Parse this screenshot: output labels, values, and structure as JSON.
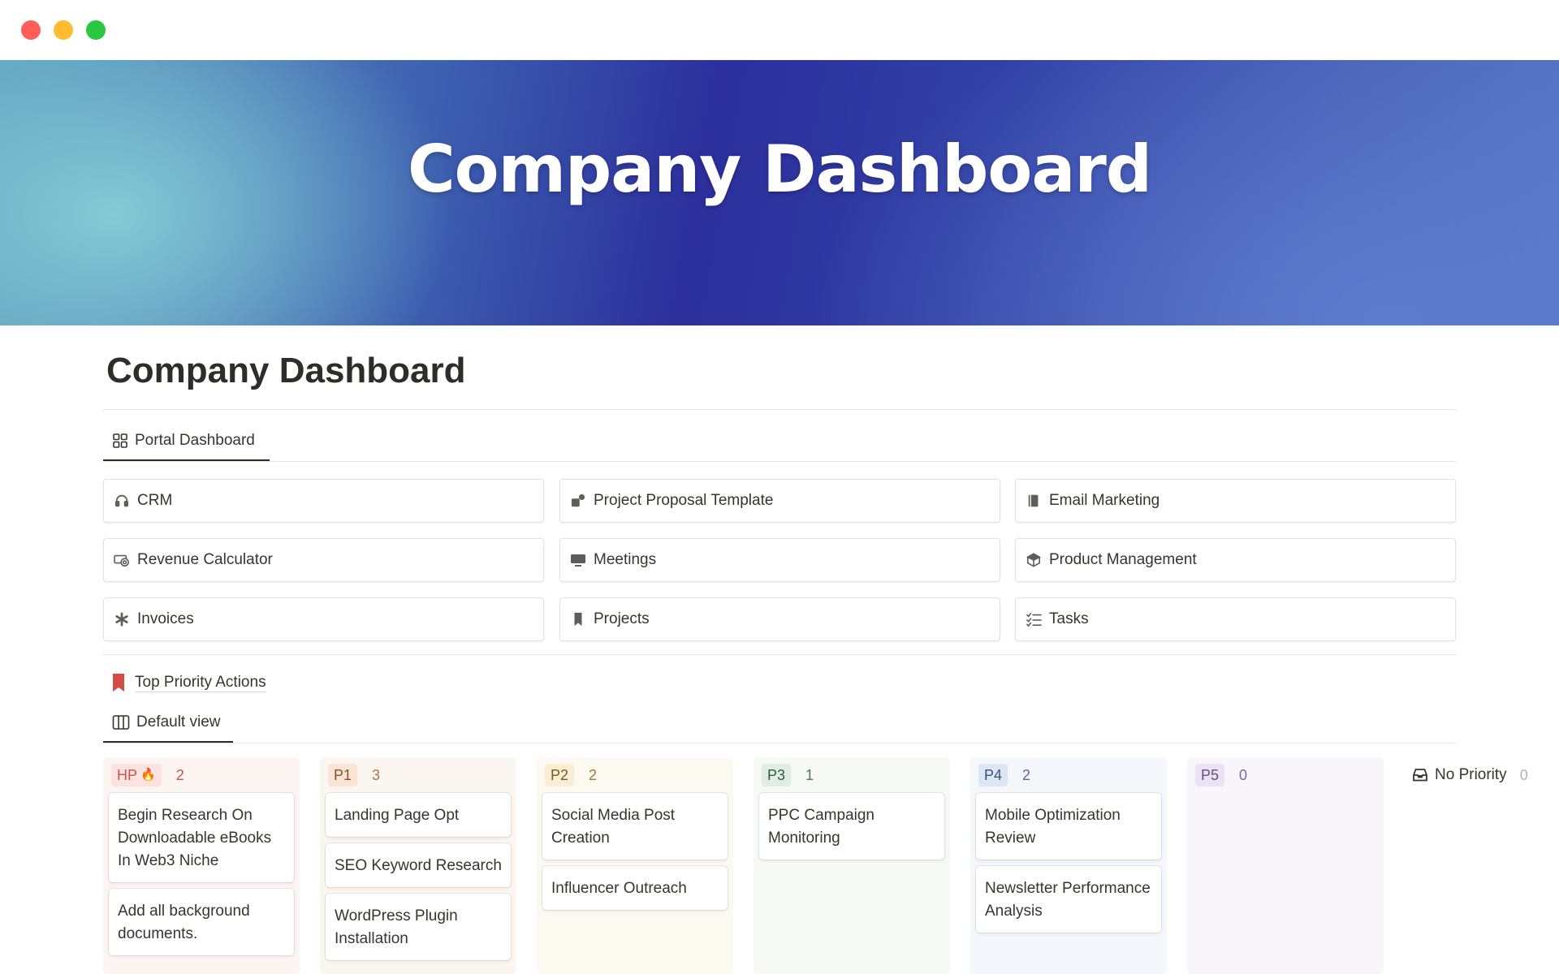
{
  "window": {
    "controls": [
      "close",
      "minimize",
      "zoom"
    ]
  },
  "banner": {
    "title": "Company Dashboard"
  },
  "page": {
    "title": "Company Dashboard"
  },
  "portal_tab": {
    "label": "Portal Dashboard",
    "icon": "grid-icon"
  },
  "links": [
    {
      "label": "CRM",
      "icon": "headset-icon"
    },
    {
      "label": "Project Proposal Template",
      "icon": "shapes-icon"
    },
    {
      "label": "Email Marketing",
      "icon": "book-icon"
    },
    {
      "label": "Revenue Calculator",
      "icon": "money-icon"
    },
    {
      "label": "Meetings",
      "icon": "computer-icon"
    },
    {
      "label": "Product Management",
      "icon": "cube-icon"
    },
    {
      "label": "Invoices",
      "icon": "asterisk-icon"
    },
    {
      "label": "Projects",
      "icon": "bookmark-icon"
    },
    {
      "label": "Tasks",
      "icon": "checklist-icon"
    }
  ],
  "priority_section": {
    "title": "Top Priority Actions",
    "icon": "red-bookmark-icon",
    "icon_color": "#d44c47"
  },
  "view_tab": {
    "label": "Default view",
    "icon": "board-icon"
  },
  "board": {
    "columns": [
      {
        "label": "HP",
        "emoji": "🔥",
        "count": "2",
        "bg": "#fdf5f2",
        "pill_bg": "#fbe4e0",
        "color": "#c4554d",
        "cards": [
          "Begin Research On Downloadable eBooks In Web3 Niche",
          "Add all background documents."
        ]
      },
      {
        "label": "P1",
        "count": "3",
        "bg": "#fcf6f1",
        "pill_bg": "#fae4d4",
        "color": "#b8704a",
        "cards": [
          "Landing Page Opt",
          "SEO Keyword Research",
          "WordPress Plugin Installation"
        ]
      },
      {
        "label": "P2",
        "count": "2",
        "bg": "#fcf9f1",
        "pill_bg": "#faeed4",
        "color": "#a77a2c",
        "cards": [
          "Social Media Post Creation",
          "Influencer Outreach"
        ]
      },
      {
        "label": "P3",
        "count": "1",
        "bg": "#f6f9f5",
        "pill_bg": "#e0ede2",
        "color": "#4d7a57",
        "cards": [
          "PPC Campaign Monitoring"
        ]
      },
      {
        "label": "P4",
        "count": "2",
        "bg": "#f4f7fb",
        "pill_bg": "#dde7f3",
        "color": "#4f6f97",
        "cards": [
          "Mobile Optimization Review",
          "Newsletter Performance Analysis"
        ]
      },
      {
        "label": "P5",
        "count": "0",
        "bg": "#f8f5fb",
        "pill_bg": "#ebe2f3",
        "color": "#8663a8",
        "cards": []
      },
      {
        "label": "No Priority",
        "icon": "inbox-icon",
        "count": "0",
        "bg": "#ffffff",
        "pill_bg": "transparent",
        "color": "#37352f",
        "cards": []
      }
    ]
  }
}
